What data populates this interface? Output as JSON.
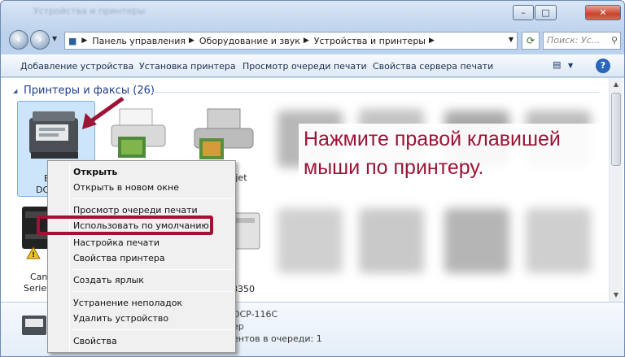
{
  "window": {
    "title": "Устройства и принтеры",
    "controls": {
      "minimize": "–",
      "maximize": "□",
      "close": "✕"
    }
  },
  "navigation": {
    "breadcrumb": [
      "Панель управления",
      "Оборудование и звук",
      "Устройства и принтеры"
    ],
    "search_placeholder": "Поиск: Ус..."
  },
  "toolbar": {
    "items": [
      "Добавление устройства",
      "Установка принтера",
      "Просмотр очереди печати",
      "Свойства сервера печати"
    ],
    "help": "?"
  },
  "group": {
    "title": "Принтеры и факсы (26)"
  },
  "printers": {
    "item1_line1": "B",
    "item1_line2": "DC",
    "item2_label": "kjet",
    "item3_line1": "Canc",
    "item3_line2": "Series",
    "item4_label": "3350"
  },
  "context_menu": {
    "items": [
      "Открыть",
      "Открыть в новом окне",
      "Просмотр очереди печати",
      "Использовать по умолчанию",
      "Настройка печати",
      "Свойства принтера",
      "Создать ярлык",
      "Устранение неполадок",
      "Удалить устройство",
      "Свойства"
    ]
  },
  "annotation": {
    "line1": "Нажмите правой клавишей",
    "line2": "мыши по принтеру."
  },
  "details": {
    "model": "DCP-116C",
    "status_suffix": "ер",
    "queue": "ентов в очереди: 1"
  },
  "colors": {
    "highlight": "#9d1434",
    "annotation_text": "#9b1436",
    "selection": "#cde5fb"
  }
}
